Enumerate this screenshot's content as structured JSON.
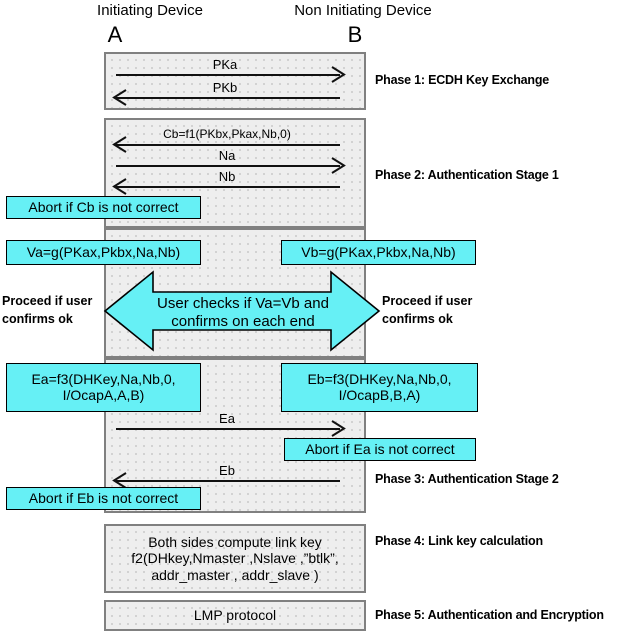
{
  "headers": {
    "left_device": "Initiating Device",
    "right_device": "Non Initiating Device",
    "left_letter": "A",
    "right_letter": "B"
  },
  "phases": [
    {
      "id": "phase1",
      "label": "Phase 1: ECDH Key Exchange"
    },
    {
      "id": "phase2",
      "label": "Phase 2: Authentication Stage 1"
    },
    {
      "id": "phase3",
      "label": "Phase 3: Authentication Stage 2"
    },
    {
      "id": "phase4",
      "label": "Phase 4: Link key calculation"
    },
    {
      "id": "phase5",
      "label": "Phase 5: Authentication and Encryption"
    }
  ],
  "messages": {
    "pka": "PKa",
    "pkb": "PKb",
    "cb": "Cb=f1(PKbx,Pkax,Nb,0)",
    "na": "Na",
    "nb": "Nb",
    "ea": "Ea",
    "eb": "Eb"
  },
  "callouts": {
    "abort_cb": "Abort if Cb is not correct",
    "va": "Va=g(PKax,Pkbx,Na,Nb)",
    "vb": "Vb=g(PKax,Pkbx,Na,Nb)",
    "ea_box": "Ea=f3(DHKey,Na,Nb,0,\nI/OcapA,A,B)",
    "eb_box": "Eb=f3(DHKey,Na,Nb,0,\nI/OcapB,B,A)",
    "abort_ea": "Abort if Ea is not correct",
    "abort_eb": "Abort if Eb is not correct"
  },
  "notes": {
    "proceed_left": "Proceed if user\nconfirms ok",
    "proceed_right": "Proceed if user\nconfirms ok",
    "user_check": "User checks if Va=Vb and\nconfirms on each end"
  },
  "panels": {
    "link_key": "Both sides compute link key\nf2(DHkey,Nmaster ,Nslave ,”btlk”,\naddr_master , addr_slave )",
    "lmp": "LMP protocol"
  },
  "colors": {
    "cyan": "#66f0f5",
    "panel_grey": "#eeeeee",
    "panel_border": "#808080",
    "ink": "#000000"
  }
}
